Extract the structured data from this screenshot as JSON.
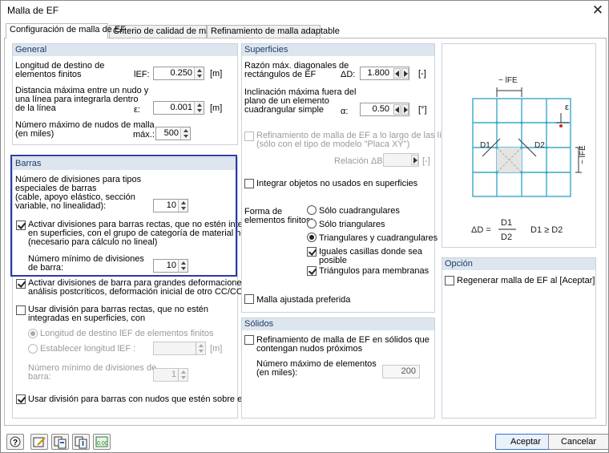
{
  "window": {
    "title": "Malla de EF",
    "close": "✕"
  },
  "tabs": [
    {
      "label": "Configuración de malla de EF"
    },
    {
      "label": "Criterio de calidad de malla"
    },
    {
      "label": "Refinamiento de malla adaptable"
    }
  ],
  "general": {
    "title": "General",
    "target_label_1": "Longitud de destino de",
    "target_label_2": "elementos finitos",
    "target_sym": "lEF:",
    "target_val": "0.250",
    "target_unit": "[m]",
    "dist_label_1": "Distancia máxima entre un nudo y",
    "dist_label_2": "una línea para integrarla dentro",
    "dist_label_3": "de la línea",
    "dist_sym": "ε:",
    "dist_val": "0.001",
    "dist_unit": "[m]",
    "maxnodes_label_1": "Número máximo de nudos de malla",
    "maxnodes_label_2": "(en miles)",
    "maxnodes_sym": "máx.:",
    "maxnodes_val": "500"
  },
  "barras": {
    "title": "Barras",
    "div_label_1": "Número de divisiones para tipos",
    "div_label_2": "especiales de barras",
    "div_label_3": "(cable, apoyo elástico, sección",
    "div_label_4": "variable, no linealidad):",
    "div_val": "10",
    "activate_label_1": "Activar divisiones para barras rectas, que no estén integradas",
    "activate_label_2": "en superficies, con el grupo de categoría de material hormigón",
    "activate_label_3": "(necesario para cálculo no lineal)",
    "min_div_label_1": "Número mínimo de divisiones",
    "min_div_label_2": "de barra:",
    "min_div_val": "10",
    "large_def_label_1": "Activar divisiones de barra para grandes deformaciones o",
    "large_def_label_2": "análisis postcríticos, deformación inicial de otro CC/CO",
    "use_div_label_1": "Usar división para barras rectas, que no estén",
    "use_div_label_2": "integradas en superficies, con",
    "radio_target": "Longitud de destino lEF de elementos finitos",
    "radio_set": "Establecer longitud lEF :",
    "set_unit": "[m]",
    "min_div2_label_1": "Número mínimo de divisiones de",
    "min_div2_label_2": "barra:",
    "min_div2_val": "1",
    "nodes_on_label": "Usar división para barras con nudos que estén sobre ellas"
  },
  "superficies": {
    "title": "Superficies",
    "ratio_label_1": "Razón máx. diagonales de",
    "ratio_label_2": "rectángulos de EF",
    "ratio_sym": "ΔD:",
    "ratio_val": "1.800",
    "ratio_unit": "[-]",
    "incl_label_1": "Inclinación máxima fuera del",
    "incl_label_2": "plano de un elemento",
    "incl_label_3": "cuadrangular simple",
    "incl_sym": "α:",
    "incl_val": "0.50",
    "incl_unit": "[°]",
    "refine_label_1": "Refinamiento de malla de EF a lo largo de las líneas",
    "refine_label_2": "(sólo con el tipo de modelo \"Placa XY\")",
    "relation_label": "Relación ΔB:",
    "relation_unit": "[-]",
    "integrate_label": "Integrar objetos no usados en superficies",
    "shape_label_1": "Forma de",
    "shape_label_2": "elementos finitos:",
    "opt_quad": "Sólo cuadrangulares",
    "opt_tri": "Sólo triangulares",
    "opt_both": "Triangulares y cuadrangulares",
    "equal_label_1": "Iguales casillas donde sea",
    "equal_label_2": "posible",
    "membrane_label": "Triángulos para membranas",
    "adjusted_label": "Malla ajustada preferida"
  },
  "solidos": {
    "title": "Sólidos",
    "refine_label_1": "Refinamiento de malla de EF en sólidos que",
    "refine_label_2": "contengan nudos próximos",
    "max_label_1": "Número  máximo de elementos",
    "max_label_2": "(en miles):",
    "max_val": "200"
  },
  "diagram": {
    "lfe_top": "~ lFE",
    "lfe_side": "~ lFE",
    "eps": "ε",
    "d1": "D1",
    "d2": "D2",
    "formula_lhs": "ΔD =",
    "formula_num": "D1",
    "formula_den": "D2",
    "formula_cond": "D1 ≥ D2"
  },
  "opcion": {
    "title": "Opción",
    "regen_label": "Regenerar malla de EF al [Aceptar]"
  },
  "footer": {
    "ok": "Aceptar",
    "cancel": "Cancelar"
  },
  "colors": {
    "accent": "#2b3aa8",
    "group_head": "#dde6ef",
    "grid": "#39a9c9"
  }
}
